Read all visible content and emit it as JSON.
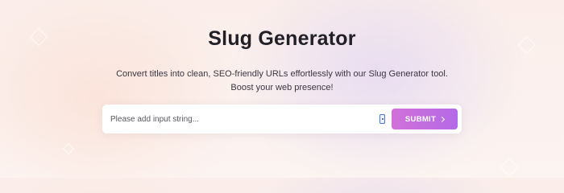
{
  "page": {
    "title": "Slug Generator",
    "description": "Convert titles into clean, SEO-friendly URLs effortlessly with our Slug Generator tool. Boost your web presence!"
  },
  "search": {
    "value": "",
    "placeholder": "Please add input string..."
  },
  "submit": {
    "label": "SUBMIT",
    "icon": "chevron-right-icon"
  },
  "colors": {
    "accent_start": "#d071d8",
    "accent_end": "#b46ae6",
    "title": "#222027",
    "background": "#fbeeea"
  }
}
